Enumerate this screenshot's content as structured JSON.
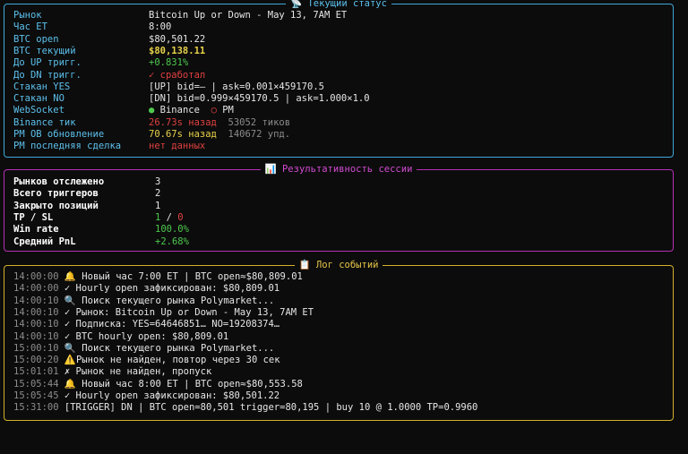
{
  "status": {
    "title": "📡 Текущий статус",
    "rows": [
      {
        "label": "Рынок",
        "value": "Bitcoin Up or Down - May 13, 7AM ET"
      },
      {
        "label": "Час ET",
        "value": "8:00"
      },
      {
        "label": "BTC open",
        "value": "$80,501.22"
      },
      {
        "label": "BTC текущий",
        "value": "$80,138.11"
      },
      {
        "label": "До UP тригг.",
        "value": "+0.831%"
      },
      {
        "label": "До DN тригг.",
        "value": "✓ сработал"
      },
      {
        "label": "Стакан YES",
        "value": "[UP] bid=— | ask=0.001×459170.5"
      },
      {
        "label": "Стакан NO",
        "value": "[DN] bid=0.999×459170.5 | ask=1.000×1.0"
      },
      {
        "label": "WebSocket",
        "dot1": "●",
        "value1": "Binance",
        "dot2": "○",
        "value2": "PM"
      },
      {
        "label": "Binance тик",
        "value1": "26.73s назад",
        "value2": "53052 тиков"
      },
      {
        "label": "PM OB обновление",
        "value1": "70.67s назад",
        "value2": "140672 упд."
      },
      {
        "label": "PM последняя сделка",
        "value": "нет данных"
      }
    ]
  },
  "performance": {
    "title": "📊 Результативность сессии",
    "rows": [
      {
        "label": "Рынков отслежено",
        "value": "3"
      },
      {
        "label": "Всего триггеров",
        "value": "2"
      },
      {
        "label": "Закрыто позиций",
        "value": "1"
      },
      {
        "label": "TP / SL",
        "tp": "1",
        "sep": " / ",
        "sl": "0"
      },
      {
        "label": "Win rate",
        "value": "100.0%"
      },
      {
        "label": "Средний PnL",
        "value": "+2.68%"
      }
    ]
  },
  "log": {
    "title": "📋 Лог событий",
    "entries": [
      {
        "time": "14:00:00",
        "text": "🔔 Новый час 7:00 ET | BTC open≈$80,809.01"
      },
      {
        "time": "14:00:00",
        "text": "✓ Hourly open зафиксирован: $80,809.01"
      },
      {
        "time": "14:00:10",
        "text": "🔍 Поиск текущего рынка Polymarket..."
      },
      {
        "time": "14:00:10",
        "text": "✓ Рынок: Bitcoin Up or Down - May 13, 7AM ET"
      },
      {
        "time": "14:00:10",
        "text": "✓ Подписка: YES=64646851… NO=19208374…"
      },
      {
        "time": "14:00:10",
        "text": "✓ BTC hourly open: $80,809.01"
      },
      {
        "time": "15:00:10",
        "text": "🔍 Поиск текущего рынка Polymarket..."
      },
      {
        "time": "15:00:20",
        "text": "⚠️Рынок не найден, повтор через 30 сек"
      },
      {
        "time": "15:01:01",
        "text": "✗ Рынок не найден, пропуск"
      },
      {
        "time": "15:05:44",
        "text": "🔔 Новый час 8:00 ET | BTC open≈$80,553.58"
      },
      {
        "time": "15:05:45",
        "text": "✓ Hourly open зафиксирован: $80,501.22"
      },
      {
        "time": "15:31:00",
        "text": "[TRIGGER] DN | BTC open=80,501 trigger=80,195 | buy 10 @ 1.0000 TP=0.9960"
      }
    ]
  },
  "colors": {
    "status_border": "#3fa9d9",
    "perf_border": "#b62fb6",
    "log_border": "#d4b02a",
    "positive": "#4ec94e",
    "negative": "#e04040",
    "highlight": "#e8d24a"
  }
}
